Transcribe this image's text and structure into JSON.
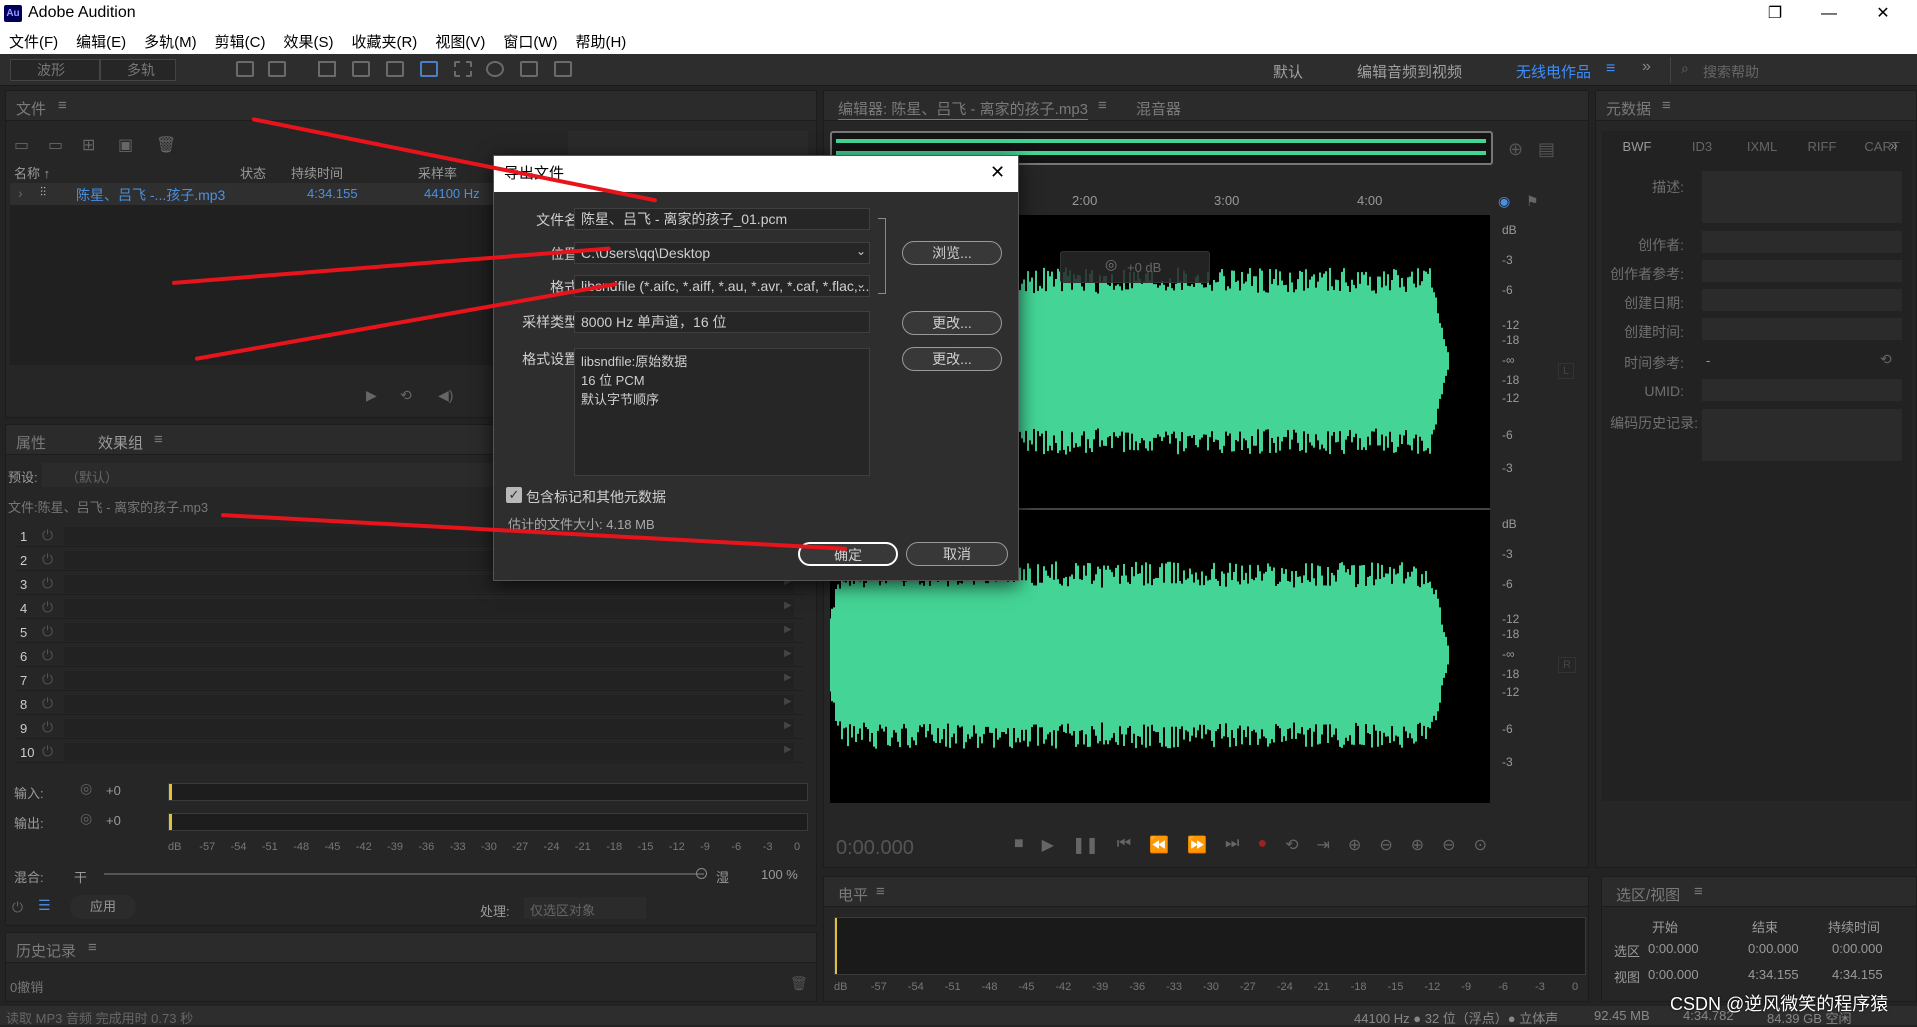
{
  "window": {
    "title": "Adobe Audition",
    "icon_text": "Au",
    "controls": [
      "—",
      "❐",
      "✕"
    ]
  },
  "menu": [
    "文件(F)",
    "编辑(E)",
    "多轨(M)",
    "剪辑(C)",
    "效果(S)",
    "收藏夹(R)",
    "视图(V)",
    "窗口(W)",
    "帮助(H)"
  ],
  "toolbar": {
    "mode_waveform": "波形",
    "mode_multitrack": "多轨",
    "workspaces": [
      "默认",
      "编辑音频到视频",
      "无线电作品"
    ],
    "search_placeholder": "搜索帮助"
  },
  "files_panel": {
    "title": "文件",
    "columns": [
      "名称 ↑",
      "状态",
      "持续时间",
      "采样率"
    ],
    "rows": [
      {
        "name": "陈星、吕飞 -...孩子.mp3",
        "duration": "4:34.155",
        "rate": "44100 Hz"
      }
    ]
  },
  "effects_panel": {
    "tabs": [
      "属性",
      "效果组"
    ],
    "preset_label": "预设:",
    "preset_value": "（默认）",
    "file_label": "文件:陈星、吕飞 - 离家的孩子.mp3",
    "rack": [
      "1",
      "2",
      "3",
      "4",
      "5",
      "6",
      "7",
      "8",
      "9",
      "10"
    ],
    "input_label": "输入:",
    "input_value": "+0",
    "output_label": "输出:",
    "output_value": "+0",
    "scale": [
      "dB",
      "-57",
      "-54",
      "-51",
      "-48",
      "-45",
      "-42",
      "-39",
      "-36",
      "-33",
      "-30",
      "-27",
      "-24",
      "-21",
      "-18",
      "-15",
      "-12",
      "-9",
      "-6",
      "-3",
      "0"
    ],
    "mix_label": "混合:",
    "mix_dry": "干",
    "mix_wet": "湿",
    "mix_value": "100 %",
    "apply": "应用",
    "process_label": "处理:",
    "process_value": "仅选区对象"
  },
  "history_panel": {
    "title": "历史记录",
    "undo": "0撤销"
  },
  "status": {
    "left": "读取 MP3 音频 完成用时 0.73 秒",
    "right": [
      "44100 Hz ● 32 位（浮点）● 立体声",
      "92.45 MB",
      "4:34.782",
      "84.39 GB 空闲"
    ]
  },
  "editor": {
    "tab": "编辑器: 陈星、吕飞 - 离家的孩子.mp3",
    "mixer_tab": "混音器",
    "time_ruler": [
      "2:00",
      "3:00",
      "4:00"
    ],
    "db_labels_top": [
      "dB",
      "-3",
      "-6",
      "-12",
      "-18",
      "-∞",
      "-18",
      "-12",
      "-6",
      "-3"
    ],
    "db_labels_bottom": [
      "dB",
      "-3",
      "-6",
      "-12",
      "-18",
      "-∞",
      "-18",
      "-12",
      "-6",
      "-3"
    ],
    "channel_l": "L",
    "channel_r": "R",
    "hud_value": "+0 dB",
    "timecode": "0:00.000",
    "wave_color": "#44d496"
  },
  "levels_panel": {
    "title": "电平",
    "scale": [
      "dB",
      "-57",
      "-54",
      "-51",
      "-48",
      "-45",
      "-42",
      "-39",
      "-36",
      "-33",
      "-30",
      "-27",
      "-24",
      "-21",
      "-18",
      "-15",
      "-12",
      "-9",
      "-6",
      "-3",
      "0"
    ]
  },
  "metadata_panel": {
    "title": "元数据",
    "tabs": [
      "BWF",
      "ID3",
      "IXML",
      "RIFF",
      "CART"
    ],
    "fields": [
      "描述:",
      "创作者:",
      "创作者参考:",
      "创建日期:",
      "创建时间:",
      "时间参考:",
      "UMID:",
      "编码历史记录:"
    ],
    "time_ref_value": "-"
  },
  "selection_panel": {
    "title": "选区/视图",
    "headers": [
      "开始",
      "结束",
      "持续时间"
    ],
    "rows": [
      {
        "label": "选区",
        "start": "0:00.000",
        "end": "0:00.000",
        "dur": "0:00.000"
      },
      {
        "label": "视图",
        "start": "0:00.000",
        "end": "4:34.155",
        "dur": "4:34.155"
      }
    ]
  },
  "dialog": {
    "title": "导出文件",
    "filename_label": "文件名:",
    "filename": "陈星、吕飞 - 离家的孩子_01.pcm",
    "location_label": "位置:",
    "location": "C:\\Users\\qq\\Desktop",
    "format_label": "格式:",
    "format": "libsndfile (*.aifc, *.aiff, *.au, *.avr, *.caf, *.flac,...",
    "sample_label": "采样类型:",
    "sample": "8000 Hz 单声道，16 位",
    "settings_label": "格式设置:",
    "settings_lines": [
      "libsndfile:原始数据",
      "16 位 PCM",
      "默认字节顺序"
    ],
    "browse": "浏览...",
    "change1": "更改...",
    "change2": "更改...",
    "include_meta": "包含标记和其他元数据",
    "est_size": "估计的文件大小: 4.18 MB",
    "ok": "确定",
    "cancel": "取消"
  },
  "watermark": "CSDN @逆风微笑的程序猿"
}
